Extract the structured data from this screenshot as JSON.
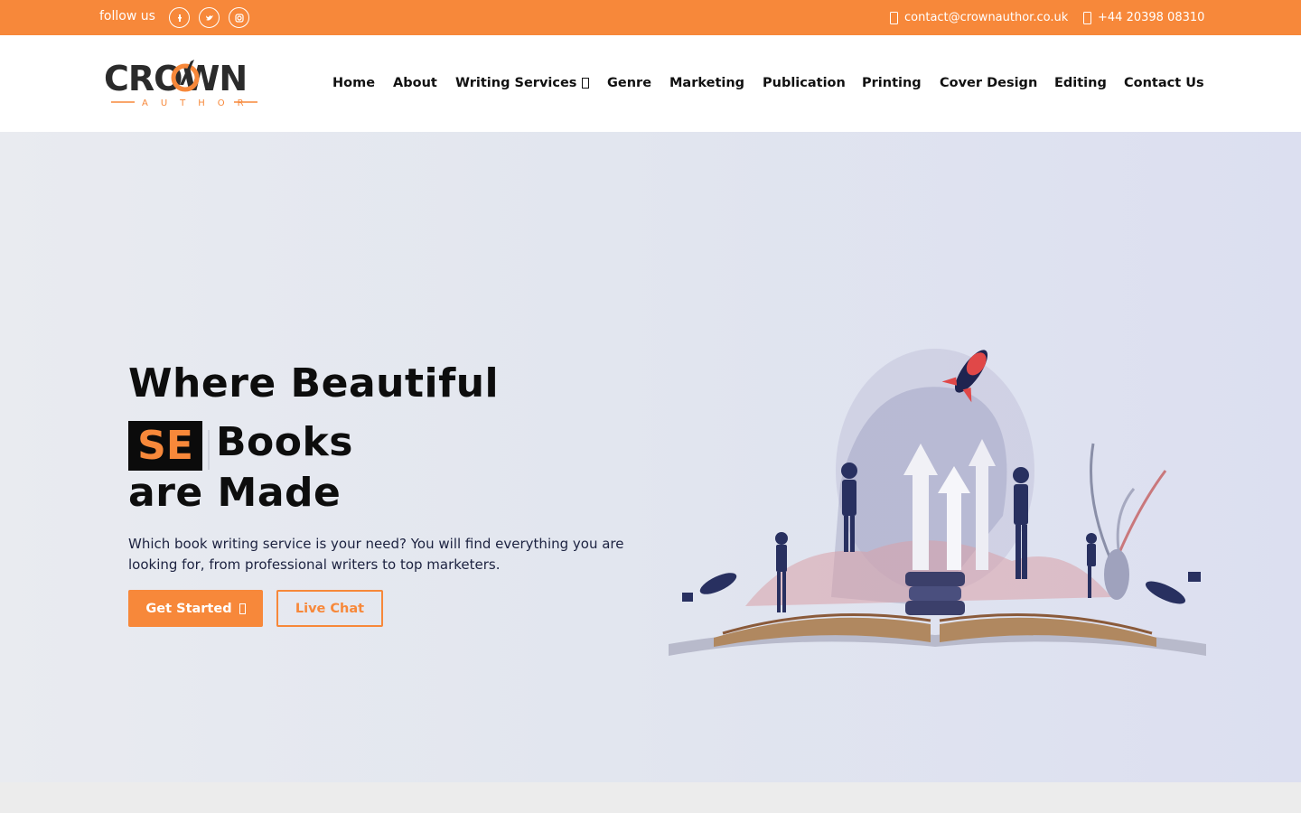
{
  "topbar": {
    "follow_label": "follow us",
    "social": [
      "facebook-icon",
      "twitter-icon",
      "instagram-icon"
    ],
    "email": "contact@crownauthor.co.uk",
    "phone": "+44 20398 08310"
  },
  "brand": {
    "name": "CROWN",
    "tagline": "AUTHOR",
    "accent_color": "#f7883a",
    "dark_color": "#2b2b2b"
  },
  "nav": {
    "items": [
      "Home",
      "About",
      "Writing Services",
      "Genre",
      "Marketing",
      "Publication",
      "Printing",
      "Cover Design",
      "Editing",
      "Contact Us"
    ]
  },
  "hero": {
    "line1": "Where Beautiful",
    "typed_text": "SE",
    "line2_rest": "Books",
    "line3": "are Made",
    "description": "Which book writing service is your need? You will find everything you are looking for, from professional writers to top marketers.",
    "primary_cta": "Get Started",
    "secondary_cta": "Live Chat"
  }
}
